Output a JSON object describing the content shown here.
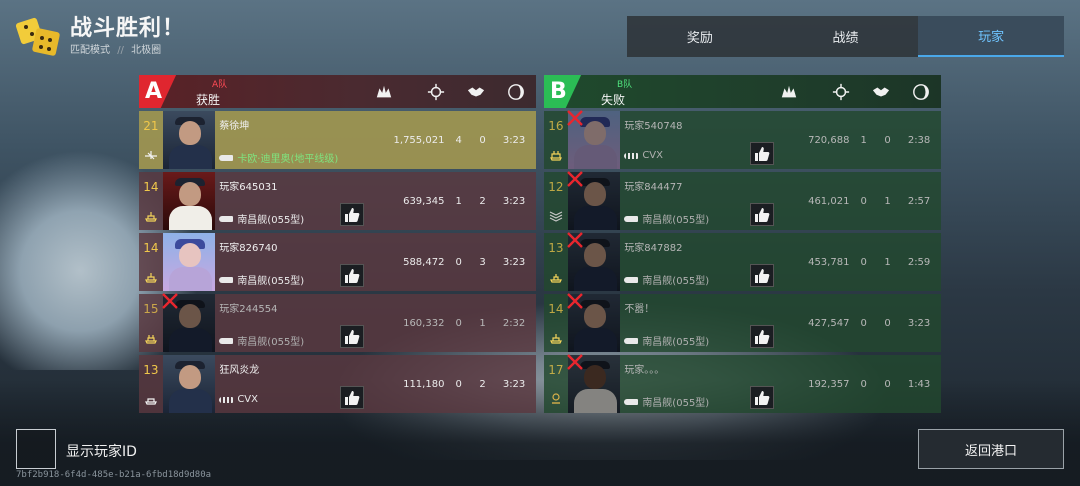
{
  "header": {
    "title": "战斗胜利！",
    "mode": "匹配模式",
    "separator": "//",
    "map": "北极圈"
  },
  "tabs": [
    {
      "label": "奖励"
    },
    {
      "label": "战绩"
    },
    {
      "label": "玩家",
      "active": true
    }
  ],
  "team_a": {
    "letter": "A",
    "name": "A队",
    "result": "获胜",
    "players": [
      {
        "level": "21",
        "name": "蔡徐坤",
        "ship": "卡欧·迪里奥(地平线级)",
        "score": "1,755,021",
        "kills": "4",
        "assists": "0",
        "time": "3:23",
        "highlight": true,
        "dead": false
      },
      {
        "level": "14",
        "name": "玩家645031",
        "ship": "南昌舰(055型)",
        "score": "639,345",
        "kills": "1",
        "assists": "2",
        "time": "3:23",
        "dead": false
      },
      {
        "level": "14",
        "name": "玩家826740",
        "ship": "南昌舰(055型)",
        "score": "588,472",
        "kills": "0",
        "assists": "3",
        "time": "3:23",
        "dead": false
      },
      {
        "level": "15",
        "name": "玩家244554",
        "ship": "南昌舰(055型)",
        "score": "160,332",
        "kills": "0",
        "assists": "1",
        "time": "2:32",
        "dead": true
      },
      {
        "level": "13",
        "name": "狂风炎龙",
        "ship": "CVX",
        "score": "111,180",
        "kills": "0",
        "assists": "2",
        "time": "3:23",
        "dead": false
      }
    ]
  },
  "team_b": {
    "letter": "B",
    "name": "B队",
    "result": "失败",
    "players": [
      {
        "level": "16",
        "name": "玩家540748",
        "ship": "CVX",
        "score": "720,688",
        "kills": "1",
        "assists": "0",
        "time": "2:38",
        "dead": true
      },
      {
        "level": "12",
        "name": "玩家844477",
        "ship": "南昌舰(055型)",
        "score": "461,021",
        "kills": "0",
        "assists": "1",
        "time": "2:57",
        "dead": true
      },
      {
        "level": "13",
        "name": "玩家847882",
        "ship": "南昌舰(055型)",
        "score": "453,781",
        "kills": "0",
        "assists": "1",
        "time": "2:59",
        "dead": true
      },
      {
        "level": "14",
        "name": "不嚣！",
        "ship": "南昌舰(055型)",
        "score": "427,547",
        "kills": "0",
        "assists": "0",
        "time": "3:23",
        "dead": true
      },
      {
        "level": "17",
        "name": "玩家。。。",
        "ship": "南昌舰(055型)",
        "score": "192,357",
        "kills": "0",
        "assists": "0",
        "time": "1:43",
        "dead": true
      }
    ]
  },
  "footer": {
    "show_id_label": "显示玩家ID",
    "match_id": "7bf2b918-6f4d-485e-b21a-6fbd18d9d80a",
    "return_label": "返回港口"
  },
  "colors": {
    "team_a": "#e0262f",
    "team_b": "#2bbd55",
    "active_tab": "#6fc4ff",
    "level": "#f0c84a"
  }
}
